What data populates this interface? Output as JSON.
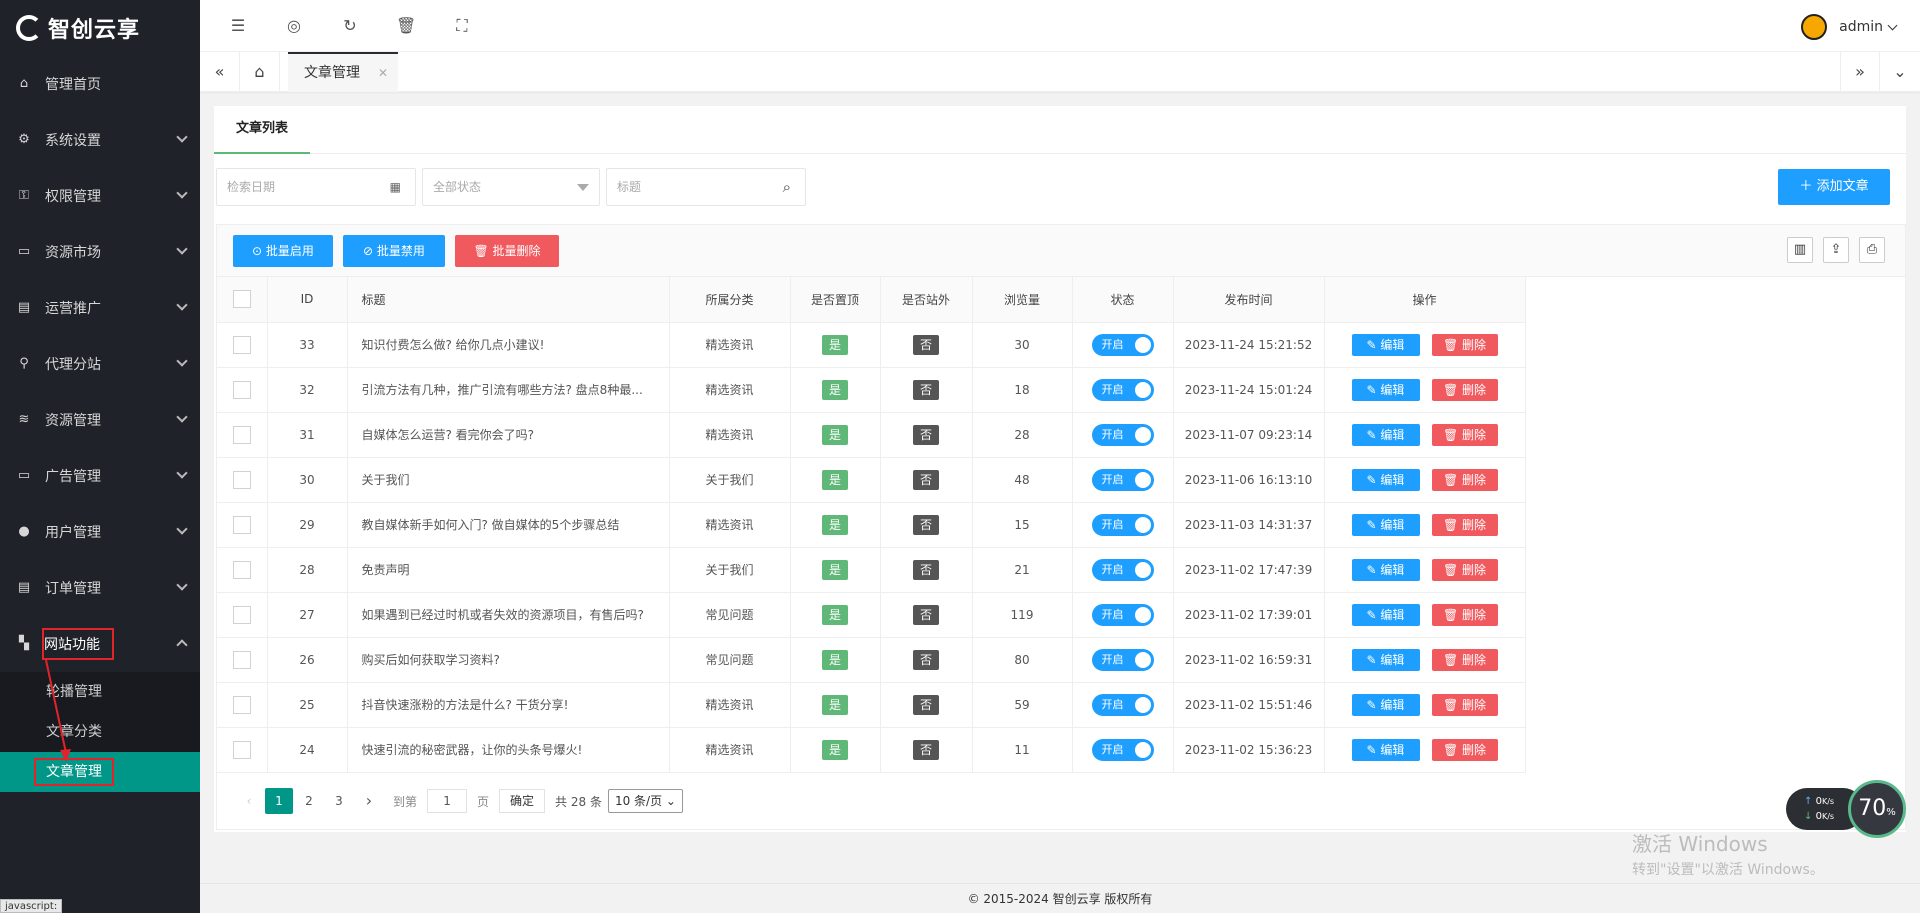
{
  "brand": {
    "name": "智创云享"
  },
  "sidebar": {
    "items": [
      {
        "label": "管理首页",
        "icon": "home-icon"
      },
      {
        "label": "系统设置",
        "icon": "gear-icon"
      },
      {
        "label": "权限管理",
        "icon": "permission-icon"
      },
      {
        "label": "资源市场",
        "icon": "store-icon"
      },
      {
        "label": "运营推广",
        "icon": "promotion-icon"
      },
      {
        "label": "代理分站",
        "icon": "agent-icon"
      },
      {
        "label": "资源管理",
        "icon": "layers-icon"
      },
      {
        "label": "广告管理",
        "icon": "ad-icon"
      },
      {
        "label": "用户管理",
        "icon": "user-icon"
      },
      {
        "label": "订单管理",
        "icon": "order-icon"
      },
      {
        "label": "网站功能",
        "icon": "apps-icon"
      }
    ],
    "sub_items": [
      {
        "label": "轮播管理"
      },
      {
        "label": "文章分类"
      },
      {
        "label": "文章管理"
      }
    ],
    "status_tip": "javascript:"
  },
  "topbar": {
    "user_name": "admin",
    "icons": [
      "menu-fold-icon",
      "globe-icon",
      "refresh-icon",
      "trash-icon",
      "fullscreen-icon"
    ]
  },
  "tabs": {
    "active": "文章管理"
  },
  "page": {
    "subtab": "文章列表",
    "filters": {
      "date_placeholder": "检索日期",
      "status_placeholder": "全部状态",
      "title_placeholder": "标题"
    },
    "add_button": "添加文章",
    "batch": {
      "enable": "批量启用",
      "disable": "批量禁用",
      "delete": "批量删除"
    },
    "columns": [
      "ID",
      "标题",
      "所属分类",
      "是否置顶",
      "是否站外",
      "浏览量",
      "状态",
      "发布时间",
      "操作"
    ],
    "labels": {
      "yes": "是",
      "no": "否",
      "switch_on": "开启",
      "edit": "编辑",
      "delete": "删除"
    },
    "rows": [
      {
        "id": "33",
        "title": "知识付费怎么做? 给你几点小建议!",
        "category": "精选资讯",
        "top": "是",
        "external": "否",
        "views": "30",
        "status": "开启",
        "time": "2023-11-24 15:21:52"
      },
      {
        "id": "32",
        "title": "引流方法有几种，推广引流有哪些方法? 盘点8种最...",
        "category": "精选资讯",
        "top": "是",
        "external": "否",
        "views": "18",
        "status": "开启",
        "time": "2023-11-24 15:01:24"
      },
      {
        "id": "31",
        "title": "自媒体怎么运营? 看完你会了吗?",
        "category": "精选资讯",
        "top": "是",
        "external": "否",
        "views": "28",
        "status": "开启",
        "time": "2023-11-07 09:23:14"
      },
      {
        "id": "30",
        "title": "关于我们",
        "category": "关于我们",
        "top": "是",
        "external": "否",
        "views": "48",
        "status": "开启",
        "time": "2023-11-06 16:13:10"
      },
      {
        "id": "29",
        "title": "教自媒体新手如何入门? 做自媒体的5个步骤总结",
        "category": "精选资讯",
        "top": "是",
        "external": "否",
        "views": "15",
        "status": "开启",
        "time": "2023-11-03 14:31:37"
      },
      {
        "id": "28",
        "title": "免责声明",
        "category": "关于我们",
        "top": "是",
        "external": "否",
        "views": "21",
        "status": "开启",
        "time": "2023-11-02 17:47:39"
      },
      {
        "id": "27",
        "title": "如果遇到已经过时机或者失效的资源项目，有售后吗?",
        "category": "常见问题",
        "top": "是",
        "external": "否",
        "views": "119",
        "status": "开启",
        "time": "2023-11-02 17:39:01"
      },
      {
        "id": "26",
        "title": "购买后如何获取学习资料?",
        "category": "常见问题",
        "top": "是",
        "external": "否",
        "views": "80",
        "status": "开启",
        "time": "2023-11-02 16:59:31"
      },
      {
        "id": "25",
        "title": "抖音快速涨粉的方法是什么? 干货分享!",
        "category": "精选资讯",
        "top": "是",
        "external": "否",
        "views": "59",
        "status": "开启",
        "time": "2023-11-02 15:51:46"
      },
      {
        "id": "24",
        "title": "快速引流的秘密武器，让你的头条号爆火!",
        "category": "精选资讯",
        "top": "是",
        "external": "否",
        "views": "11",
        "status": "开启",
        "time": "2023-11-02 15:36:23"
      }
    ],
    "pager": {
      "pages": [
        "1",
        "2",
        "3"
      ],
      "current": "1",
      "goto_label": "到第",
      "goto_value": "1",
      "page_unit": "页",
      "confirm": "确定",
      "total": "共 28 条",
      "page_size": "10 条/页"
    }
  },
  "footer": {
    "text": "© 2015-2024 智创云享 版权所有"
  },
  "net_widget": {
    "up": "0",
    "down": "0",
    "unit": "K/s",
    "percent": "70",
    "percent_unit": "%"
  },
  "watermark": {
    "line1": "激活 Windows",
    "line2": "转到\"设置\"以激活 Windows。"
  },
  "colors": {
    "sidebar_bg": "#20222a",
    "active_green": "#009688",
    "primary_blue": "#1e9fff",
    "danger": "#f0595d",
    "yes_green": "#5fb878"
  }
}
